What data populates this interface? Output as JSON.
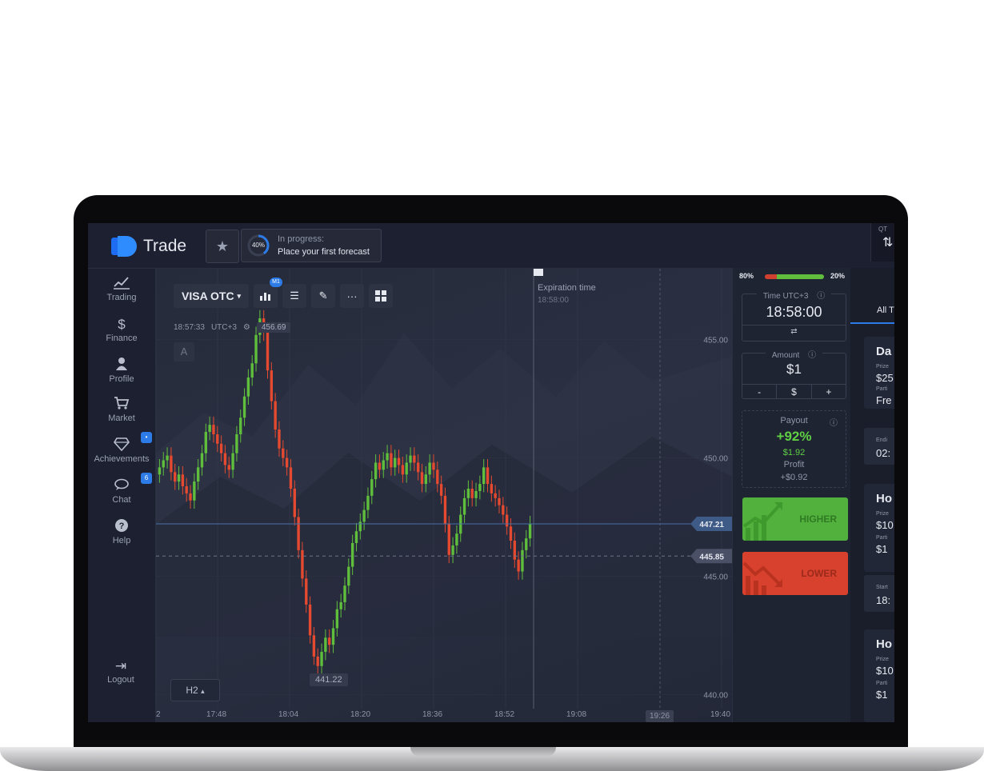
{
  "header": {
    "brand": "Trade",
    "progress": {
      "percent_label": "40%",
      "percent": 40,
      "status": "In progress:",
      "task": "Place your first forecast"
    },
    "corner_label": "QT"
  },
  "sidebar": {
    "items": [
      {
        "icon": "chart-line-icon",
        "label": "Trading"
      },
      {
        "icon": "dollar-icon",
        "label": "Finance"
      },
      {
        "icon": "user-icon",
        "label": "Profile"
      },
      {
        "icon": "cart-icon",
        "label": "Market"
      },
      {
        "icon": "diamond-icon",
        "label": "Achievements",
        "badge": "•"
      },
      {
        "icon": "chat-icon",
        "label": "Chat",
        "badge": "6"
      },
      {
        "icon": "help-icon",
        "label": "Help"
      }
    ],
    "logout": "Logout"
  },
  "chart": {
    "asset": "VISA OTC",
    "timeframe_badge": "M1",
    "clock": "18:57:33",
    "tz": "UTC+3",
    "price_chip": "456.69",
    "drawing_label": "A",
    "expiration_label": "Expiration time",
    "expiration_value": "18:58:00",
    "period": "H2",
    "min_price_chip": "441.22",
    "current_time": "19:26",
    "current_price": "447.21",
    "ref_price": "445.85"
  },
  "panel": {
    "sentiment": {
      "down": "80%",
      "up": "20%"
    },
    "time": {
      "label": "Time UTC+3",
      "value": "18:58:00"
    },
    "amount": {
      "label": "Amount",
      "value": "$1",
      "minus": "-",
      "currency": "$",
      "plus": "+"
    },
    "payout": {
      "label": "Payout",
      "percent": "+92%",
      "amount": "$1.92",
      "profit_label": "Profit",
      "profit": "+$0.92"
    },
    "higher": "HIGHER",
    "lower": "LOWER"
  },
  "tournaments": {
    "tab": "All T",
    "cards": [
      {
        "title": "Da",
        "l1": "Prize",
        "v1": "$25",
        "l2": "Parti",
        "v2": "Fre",
        "l3": "Endi",
        "v3": "02:"
      },
      {
        "title": "Ho",
        "l1": "Prize",
        "v1": "$10",
        "l2": "Parti",
        "v2": "$1",
        "l3": "Start",
        "v3": "18:"
      },
      {
        "title": "Ho",
        "l1": "Prize",
        "v1": "$10",
        "l2": "Parti",
        "v2": "$1"
      }
    ]
  },
  "colors": {
    "up": "#5fbf3d",
    "down": "#e5492f",
    "accent": "#2d7be6"
  },
  "chart_data": {
    "type": "candlestick",
    "x_ticks": [
      "2",
      "17:48",
      "18:04",
      "18:20",
      "18:36",
      "18:52",
      "19:08",
      "19:40"
    ],
    "y_ticks": [
      455.0,
      450.0,
      445.0,
      440.0
    ],
    "ylim": [
      439.4,
      458.0
    ],
    "closes": [
      449.6,
      449.9,
      450.1,
      449.4,
      449.0,
      449.3,
      448.8,
      448.5,
      448.2,
      449.0,
      449.6,
      450.2,
      451.1,
      451.4,
      451.0,
      450.6,
      450.2,
      449.7,
      449.5,
      450.2,
      451.0,
      451.7,
      452.6,
      453.4,
      454.0,
      455.2,
      455.9,
      455.3,
      453.7,
      452.4,
      451.2,
      450.4,
      450.0,
      449.6,
      448.7,
      447.5,
      446.1,
      444.9,
      443.8,
      442.5,
      441.6,
      441.2,
      441.8,
      442.4,
      442.1,
      442.8,
      443.6,
      443.9,
      444.6,
      445.4,
      446.4,
      446.9,
      447.3,
      447.8,
      448.4,
      449.1,
      449.8,
      449.5,
      449.9,
      450.2,
      449.6,
      450.0,
      449.7,
      449.3,
      449.8,
      450.1,
      449.8,
      449.4,
      448.9,
      449.3,
      449.8,
      449.5,
      448.9,
      448.4,
      447.2,
      445.9,
      446.3,
      446.8,
      447.6,
      448.3,
      448.7,
      448.3,
      448.6,
      448.9,
      449.6,
      448.9,
      448.5,
      448.3,
      448.0,
      447.6,
      447.1,
      446.5,
      445.7,
      445.2,
      446.1,
      446.6,
      447.2
    ]
  }
}
